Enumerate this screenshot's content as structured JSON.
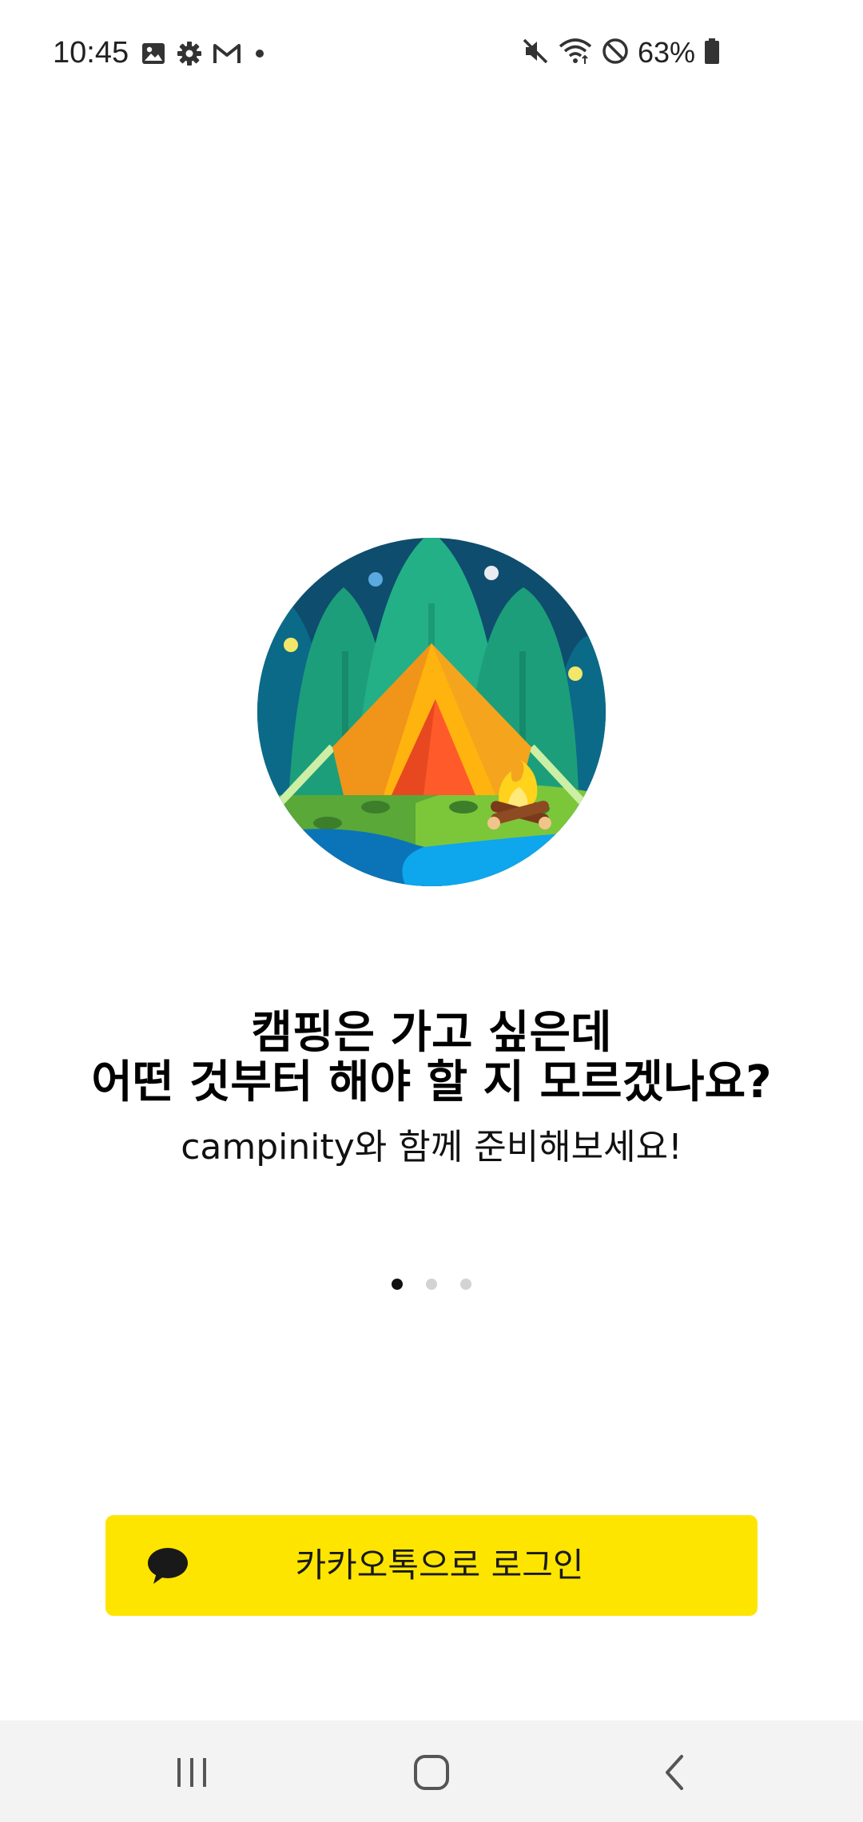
{
  "status_bar": {
    "time": "10:45",
    "battery_percent": "63%",
    "left_icons": [
      "image-icon",
      "gear-icon",
      "gmail-icon",
      "notification-dot-icon"
    ],
    "right_icons": [
      "mute-icon",
      "wifi-icon",
      "do-not-disturb-icon",
      "battery-icon"
    ]
  },
  "onboarding": {
    "illustration": "camping-tent-illustration",
    "headline_line1": "캠핑은 가고 싶은데",
    "headline_line2": "어떤 것부터 해야 할 지 모르겠나요?",
    "subtitle": "campinity와 함께 준비해보세요!",
    "page_count": 3,
    "current_page": 1
  },
  "login": {
    "kakao_label": "카카오톡으로 로그인",
    "kakao_color": "#FEE500",
    "icon": "kakao-speech-bubble-icon"
  },
  "nav_bar": {
    "buttons": [
      "recent-apps-icon",
      "home-icon",
      "back-icon"
    ]
  }
}
